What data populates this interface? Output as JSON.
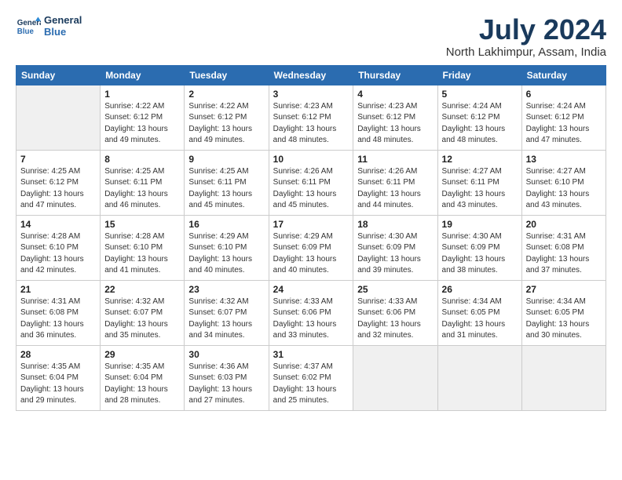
{
  "logo": {
    "line1": "General",
    "line2": "Blue"
  },
  "title": "July 2024",
  "location": "North Lakhimpur, Assam, India",
  "columns": [
    "Sunday",
    "Monday",
    "Tuesday",
    "Wednesday",
    "Thursday",
    "Friday",
    "Saturday"
  ],
  "weeks": [
    [
      {
        "num": "",
        "empty": true
      },
      {
        "num": "1",
        "sunrise": "Sunrise: 4:22 AM",
        "sunset": "Sunset: 6:12 PM",
        "daylight": "Daylight: 13 hours and 49 minutes."
      },
      {
        "num": "2",
        "sunrise": "Sunrise: 4:22 AM",
        "sunset": "Sunset: 6:12 PM",
        "daylight": "Daylight: 13 hours and 49 minutes."
      },
      {
        "num": "3",
        "sunrise": "Sunrise: 4:23 AM",
        "sunset": "Sunset: 6:12 PM",
        "daylight": "Daylight: 13 hours and 48 minutes."
      },
      {
        "num": "4",
        "sunrise": "Sunrise: 4:23 AM",
        "sunset": "Sunset: 6:12 PM",
        "daylight": "Daylight: 13 hours and 48 minutes."
      },
      {
        "num": "5",
        "sunrise": "Sunrise: 4:24 AM",
        "sunset": "Sunset: 6:12 PM",
        "daylight": "Daylight: 13 hours and 48 minutes."
      },
      {
        "num": "6",
        "sunrise": "Sunrise: 4:24 AM",
        "sunset": "Sunset: 6:12 PM",
        "daylight": "Daylight: 13 hours and 47 minutes."
      }
    ],
    [
      {
        "num": "7",
        "sunrise": "Sunrise: 4:25 AM",
        "sunset": "Sunset: 6:12 PM",
        "daylight": "Daylight: 13 hours and 47 minutes."
      },
      {
        "num": "8",
        "sunrise": "Sunrise: 4:25 AM",
        "sunset": "Sunset: 6:11 PM",
        "daylight": "Daylight: 13 hours and 46 minutes."
      },
      {
        "num": "9",
        "sunrise": "Sunrise: 4:25 AM",
        "sunset": "Sunset: 6:11 PM",
        "daylight": "Daylight: 13 hours and 45 minutes."
      },
      {
        "num": "10",
        "sunrise": "Sunrise: 4:26 AM",
        "sunset": "Sunset: 6:11 PM",
        "daylight": "Daylight: 13 hours and 45 minutes."
      },
      {
        "num": "11",
        "sunrise": "Sunrise: 4:26 AM",
        "sunset": "Sunset: 6:11 PM",
        "daylight": "Daylight: 13 hours and 44 minutes."
      },
      {
        "num": "12",
        "sunrise": "Sunrise: 4:27 AM",
        "sunset": "Sunset: 6:11 PM",
        "daylight": "Daylight: 13 hours and 43 minutes."
      },
      {
        "num": "13",
        "sunrise": "Sunrise: 4:27 AM",
        "sunset": "Sunset: 6:10 PM",
        "daylight": "Daylight: 13 hours and 43 minutes."
      }
    ],
    [
      {
        "num": "14",
        "sunrise": "Sunrise: 4:28 AM",
        "sunset": "Sunset: 6:10 PM",
        "daylight": "Daylight: 13 hours and 42 minutes."
      },
      {
        "num": "15",
        "sunrise": "Sunrise: 4:28 AM",
        "sunset": "Sunset: 6:10 PM",
        "daylight": "Daylight: 13 hours and 41 minutes."
      },
      {
        "num": "16",
        "sunrise": "Sunrise: 4:29 AM",
        "sunset": "Sunset: 6:10 PM",
        "daylight": "Daylight: 13 hours and 40 minutes."
      },
      {
        "num": "17",
        "sunrise": "Sunrise: 4:29 AM",
        "sunset": "Sunset: 6:09 PM",
        "daylight": "Daylight: 13 hours and 40 minutes."
      },
      {
        "num": "18",
        "sunrise": "Sunrise: 4:30 AM",
        "sunset": "Sunset: 6:09 PM",
        "daylight": "Daylight: 13 hours and 39 minutes."
      },
      {
        "num": "19",
        "sunrise": "Sunrise: 4:30 AM",
        "sunset": "Sunset: 6:09 PM",
        "daylight": "Daylight: 13 hours and 38 minutes."
      },
      {
        "num": "20",
        "sunrise": "Sunrise: 4:31 AM",
        "sunset": "Sunset: 6:08 PM",
        "daylight": "Daylight: 13 hours and 37 minutes."
      }
    ],
    [
      {
        "num": "21",
        "sunrise": "Sunrise: 4:31 AM",
        "sunset": "Sunset: 6:08 PM",
        "daylight": "Daylight: 13 hours and 36 minutes."
      },
      {
        "num": "22",
        "sunrise": "Sunrise: 4:32 AM",
        "sunset": "Sunset: 6:07 PM",
        "daylight": "Daylight: 13 hours and 35 minutes."
      },
      {
        "num": "23",
        "sunrise": "Sunrise: 4:32 AM",
        "sunset": "Sunset: 6:07 PM",
        "daylight": "Daylight: 13 hours and 34 minutes."
      },
      {
        "num": "24",
        "sunrise": "Sunrise: 4:33 AM",
        "sunset": "Sunset: 6:06 PM",
        "daylight": "Daylight: 13 hours and 33 minutes."
      },
      {
        "num": "25",
        "sunrise": "Sunrise: 4:33 AM",
        "sunset": "Sunset: 6:06 PM",
        "daylight": "Daylight: 13 hours and 32 minutes."
      },
      {
        "num": "26",
        "sunrise": "Sunrise: 4:34 AM",
        "sunset": "Sunset: 6:05 PM",
        "daylight": "Daylight: 13 hours and 31 minutes."
      },
      {
        "num": "27",
        "sunrise": "Sunrise: 4:34 AM",
        "sunset": "Sunset: 6:05 PM",
        "daylight": "Daylight: 13 hours and 30 minutes."
      }
    ],
    [
      {
        "num": "28",
        "sunrise": "Sunrise: 4:35 AM",
        "sunset": "Sunset: 6:04 PM",
        "daylight": "Daylight: 13 hours and 29 minutes."
      },
      {
        "num": "29",
        "sunrise": "Sunrise: 4:35 AM",
        "sunset": "Sunset: 6:04 PM",
        "daylight": "Daylight: 13 hours and 28 minutes."
      },
      {
        "num": "30",
        "sunrise": "Sunrise: 4:36 AM",
        "sunset": "Sunset: 6:03 PM",
        "daylight": "Daylight: 13 hours and 27 minutes."
      },
      {
        "num": "31",
        "sunrise": "Sunrise: 4:37 AM",
        "sunset": "Sunset: 6:02 PM",
        "daylight": "Daylight: 13 hours and 25 minutes."
      },
      {
        "num": "",
        "empty": true
      },
      {
        "num": "",
        "empty": true
      },
      {
        "num": "",
        "empty": true
      }
    ]
  ]
}
